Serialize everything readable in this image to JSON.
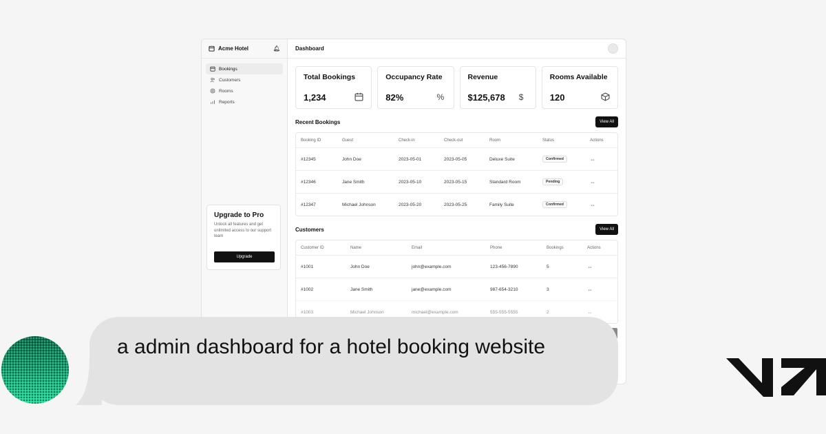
{
  "sidebar": {
    "app_name": "Acme Hotel",
    "items": [
      {
        "label": "Bookings",
        "icon": "calendar-icon",
        "active": true
      },
      {
        "label": "Customers",
        "icon": "users-icon",
        "active": false
      },
      {
        "label": "Rooms",
        "icon": "box-icon",
        "active": false
      },
      {
        "label": "Reports",
        "icon": "chart-icon",
        "active": false
      }
    ],
    "upgrade": {
      "title": "Upgrade to Pro",
      "text": "Unlock all features and get unlimited access to our support team",
      "button": "Upgrade"
    }
  },
  "header": {
    "title": "Dashboard"
  },
  "stats": [
    {
      "title": "Total Bookings",
      "value": "1,234",
      "icon": "calendar-icon"
    },
    {
      "title": "Occupancy Rate",
      "value": "82%",
      "icon": "percent-icon"
    },
    {
      "title": "Revenue",
      "value": "$125,678",
      "icon": "dollar-icon"
    },
    {
      "title": "Rooms Available",
      "value": "120",
      "icon": "box-icon"
    }
  ],
  "bookings": {
    "title": "Recent Bookings",
    "view_all": "View All",
    "columns": [
      "Booking ID",
      "Guest",
      "Check-in",
      "Check-out",
      "Room",
      "Status",
      "Actions"
    ],
    "rows": [
      {
        "id": "#12345",
        "guest": "John Doe",
        "checkin": "2023-05-01",
        "checkout": "2023-05-05",
        "room": "Deluxe Suite",
        "status": "Confirmed"
      },
      {
        "id": "#12346",
        "guest": "Jane Smith",
        "checkin": "2023-05-10",
        "checkout": "2023-05-15",
        "room": "Standard Room",
        "status": "Pending"
      },
      {
        "id": "#12347",
        "guest": "Michael Johnson",
        "checkin": "2023-05-20",
        "checkout": "2023-05-25",
        "room": "Family Suite",
        "status": "Confirmed"
      }
    ]
  },
  "customers": {
    "title": "Customers",
    "view_all": "View All",
    "columns": [
      "Customer ID",
      "Name",
      "Email",
      "Phone",
      "Bookings",
      "Actions"
    ],
    "rows": [
      {
        "id": "#1001",
        "name": "John Doe",
        "email": "john@example.com",
        "phone": "123-456-7890",
        "bookings": "5"
      },
      {
        "id": "#1002",
        "name": "Jane Smith",
        "email": "jane@example.com",
        "phone": "987-654-3210",
        "bookings": "3"
      },
      {
        "id": "#1003",
        "name": "Michael Johnson",
        "email": "michael@example.com",
        "phone": "555-555-5555",
        "bookings": "2"
      }
    ]
  },
  "chat": {
    "message": "a admin dashboard for a hotel booking website"
  },
  "colors": {
    "accent": "#111111",
    "bubble": "#e3e3e3",
    "avatar": "#16b27a"
  }
}
